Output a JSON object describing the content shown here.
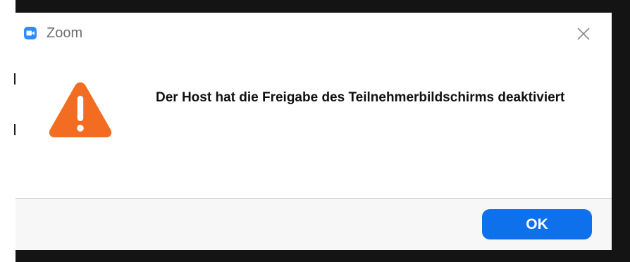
{
  "window": {
    "app_title": "Zoom",
    "app_icon": "zoom-logo-icon",
    "close_icon": "close-icon",
    "accent_color": "#2d8cff"
  },
  "dialog": {
    "icon": "warning-icon",
    "icon_color": "#f26d21",
    "message": "Der Host hat die Freigabe des Teilnehmerbildschirms deaktiviert",
    "ok_label": "OK",
    "ok_color": "#0e71eb"
  }
}
